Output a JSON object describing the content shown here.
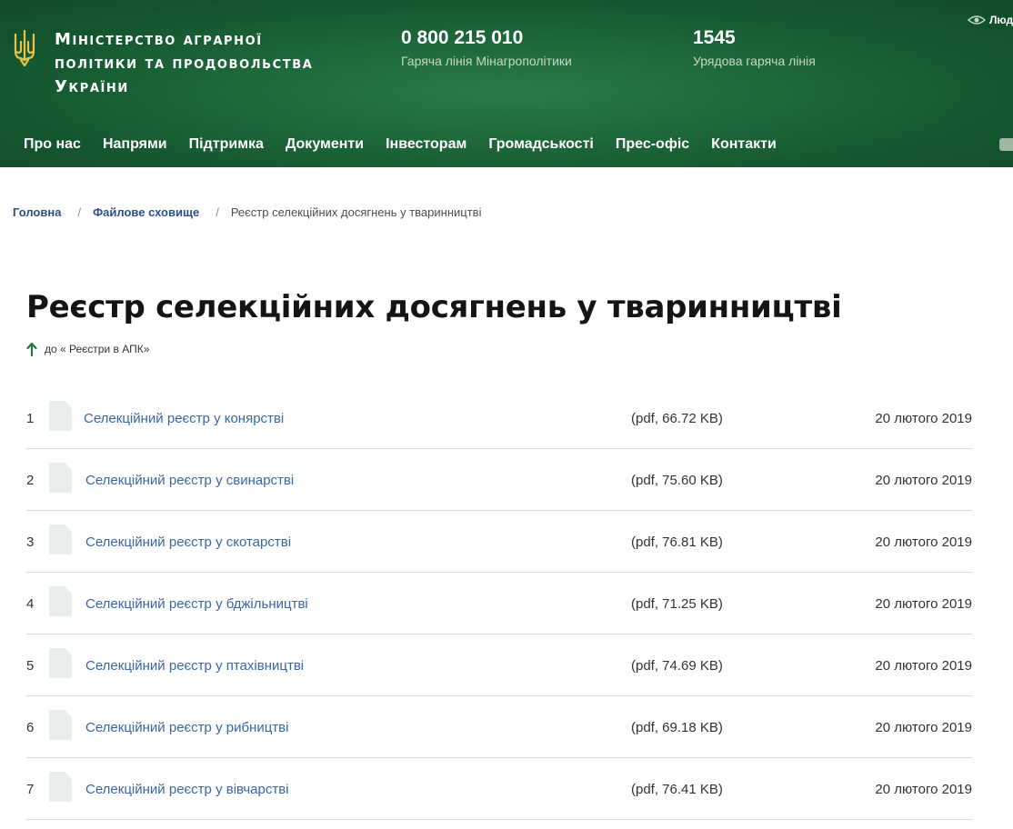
{
  "header": {
    "ministry_lines": [
      "Міністерство аграрної",
      "політики та продовольства",
      "України"
    ],
    "hotlines": [
      {
        "number": "0 800 215 010",
        "caption": "Гаряча лінія Мінагрополітики"
      },
      {
        "number": "1545",
        "caption": "Урядова гаряча лінія"
      }
    ],
    "accessibility_label": "Люд"
  },
  "nav": [
    "Про нас",
    "Напрями",
    "Підтримка",
    "Документи",
    "Інвесторам",
    "Громадськості",
    "Прес-офіс",
    "Контакти"
  ],
  "breadcrumb": {
    "items": [
      "Головна",
      "Файлове сховище"
    ],
    "separator": "/",
    "current": "Реєстр селекційних досягнень у тваринництві"
  },
  "page": {
    "title": "Реєстр селекційних досягнень у тваринництві",
    "back_link": "до « Реєстри в АПК»"
  },
  "files": [
    {
      "num": "1",
      "name": "Селекційний реєстр у конярстві",
      "size": "(pdf, 66.72 KB)",
      "date": "20 лютого 2019"
    },
    {
      "num": "2",
      "name": "Селекційний реєстр у свинарстві",
      "size": "(pdf, 75.60 KB)",
      "date": "20 лютого 2019"
    },
    {
      "num": "3",
      "name": "Селекційний реєстр у скотарстві",
      "size": "(pdf, 76.81 KB)",
      "date": "20 лютого 2019"
    },
    {
      "num": "4",
      "name": "Селекційний реєстр у бджільництві",
      "size": "(pdf, 71.25 KB)",
      "date": "20 лютого 2019"
    },
    {
      "num": "5",
      "name": "Селекційний реєстр у птахівництві",
      "size": "(pdf, 74.69 KB)",
      "date": "20 лютого 2019"
    },
    {
      "num": "6",
      "name": "Селекційний реєстр у рибництві",
      "size": "(pdf, 69.18 KB)",
      "date": "20 лютого 2019"
    },
    {
      "num": "7",
      "name": "Селекційний реєстр у вівчарстві",
      "size": "(pdf, 76.41 KB)",
      "date": "20 лютого 2019"
    }
  ],
  "colors": {
    "header_green": "#1f6a3b",
    "trident_gold": "#e8c54a",
    "link_blue": "#3a66a8",
    "breadcrumb_blue": "#2d4f87",
    "back_arrow_green": "#1f7a3c"
  },
  "icons": [
    "trident-icon",
    "eye-icon",
    "youtube-icon",
    "arrow-up-icon",
    "file-icon"
  ]
}
